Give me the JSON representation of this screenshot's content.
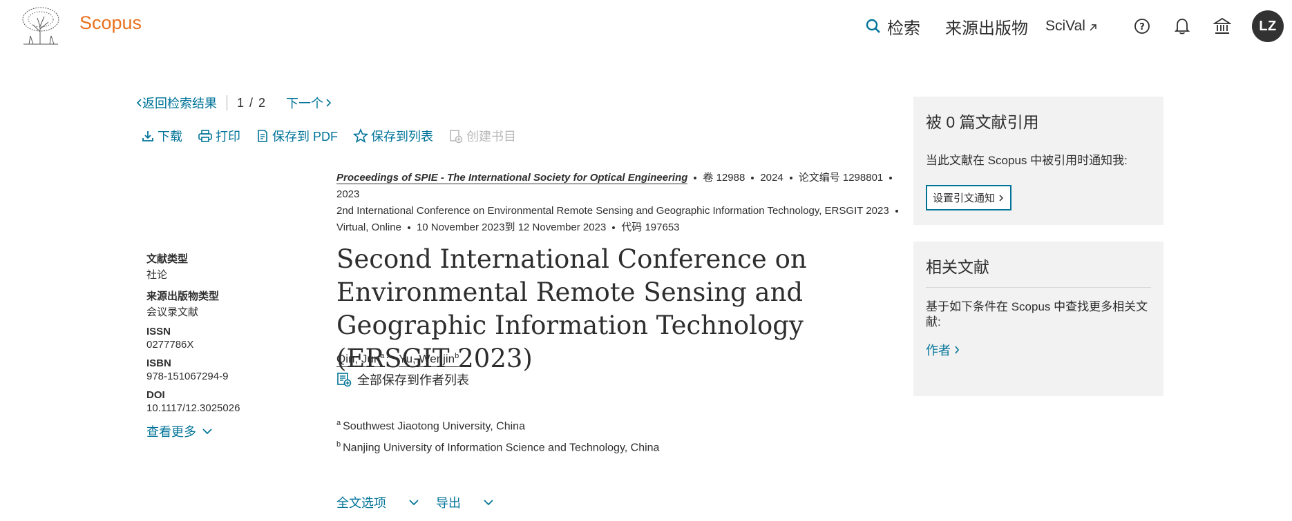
{
  "header": {
    "brand": "Scopus",
    "nav": {
      "search": "检索",
      "sources": "来源出版物",
      "scival": "SciVal"
    },
    "avatar_initials": "LZ",
    "icons": [
      "elsevier-tree-logo",
      "search-icon",
      "external-link-icon",
      "help-icon",
      "bell-icon",
      "institution-icon"
    ]
  },
  "pager": {
    "back": "返回检索结果",
    "current": "1",
    "slash": "/",
    "total": "2",
    "next": "下一个"
  },
  "tools": {
    "download": "下载",
    "print": "打印",
    "save_pdf": "保存到 PDF",
    "save_list": "保存到列表",
    "create_bib": "创建书目"
  },
  "source": {
    "journal": "Proceedings of SPIE - The International Society for Optical Engineering",
    "volume": "卷 12988",
    "year": "2024",
    "article_no": "论文编号 1298801",
    "conference_line1": "2023",
    "conference_line2": "2nd International Conference on Environmental Remote Sensing and Geographic Information Technology, ERSGIT 2023",
    "location": "Virtual, Online",
    "dates": "10 November 2023到 12 November 2023",
    "code": "代码 197653"
  },
  "meta": {
    "doc_type_label": "文献类型",
    "doc_type": "社论",
    "source_type_label": "来源出版物类型",
    "source_type": "会议录文献",
    "issn_label": "ISSN",
    "issn": "0277786X",
    "isbn_label": "ISBN",
    "isbn": "978-151067294-9",
    "doi_label": "DOI",
    "doi": "10.1117/12.3025026",
    "more": "查看更多"
  },
  "article": {
    "title": "Second International Conference on Environmental Remote Sensing and Geographic Information Technology (ERSGIT 2023)",
    "authors": [
      {
        "name": "Qin, Jun",
        "sup": "a"
      },
      {
        "name": "Yu, Wenjin",
        "sup": "b"
      }
    ],
    "author_sep": ";",
    "save_all": "全部保存到作者列表",
    "affiliations": [
      {
        "sup": "a",
        "text": "Southwest Jiaotong University, China"
      },
      {
        "sup": "b",
        "text": "Nanjing University of Information Science and Technology, China"
      }
    ],
    "full_text": "全文选项",
    "export": "导出"
  },
  "cited": {
    "title": "被 0 篇文献引用",
    "text": "当此文献在 Scopus 中被引用时通知我:",
    "button": "设置引文通知"
  },
  "related": {
    "title": "相关文献",
    "text": "基于如下条件在 Scopus 中查找更多相关文献:",
    "authors_link": "作者"
  },
  "colors": {
    "brand": "#e9711c",
    "link": "#007398",
    "panel_bg": "#f2f2f2"
  }
}
